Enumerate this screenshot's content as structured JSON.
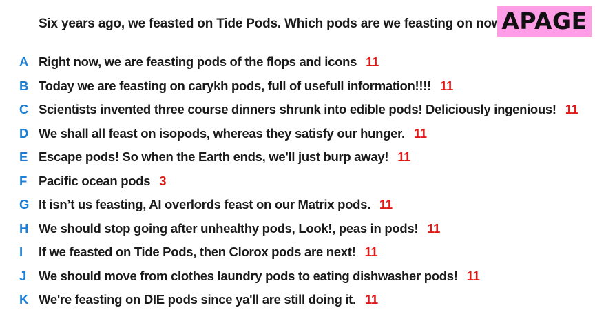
{
  "prompt": "Six years ago, we feasted on Tide Pods. Which pods are we feasting on now?",
  "badge": "APAGE",
  "colors": {
    "letter": "#1a7fd6",
    "score": "#e01818",
    "badge_bg": "#ff9ee6"
  },
  "answers": [
    {
      "letter": "A",
      "text": "Right now, we are feasting pods of the flops and icons",
      "score": "11"
    },
    {
      "letter": "B",
      "text": "Today we are feasting on carykh pods, full of usefull information!!!!",
      "score": "11"
    },
    {
      "letter": "C",
      "text": "Scientists invented three course dinners shrunk into edible pods! Deliciously ingenious!",
      "score": "11"
    },
    {
      "letter": "D",
      "text": "We shall all feast on isopods, whereas they satisfy our hunger.",
      "score": "11"
    },
    {
      "letter": "E",
      "text": "Escape pods! So when the Earth ends, we'll just burp away!",
      "score": "11"
    },
    {
      "letter": "F",
      "text": "Pacific ocean pods",
      "score": "3"
    },
    {
      "letter": "G",
      "text": "It isn’t us feasting, AI overlords feast on our Matrix pods.",
      "score": "11"
    },
    {
      "letter": "H",
      "text": "We should stop going after unhealthy pods, Look!, peas in pods!",
      "score": "11"
    },
    {
      "letter": "I",
      "text": "If we feasted on Tide Pods, then Clorox pods are next!",
      "score": "11"
    },
    {
      "letter": "J",
      "text": "We should move from clothes laundry pods to eating dishwasher pods!",
      "score": "11"
    },
    {
      "letter": "K",
      "text": "We're feasting on DIE pods since ya'll are still doing it.",
      "score": "11"
    }
  ]
}
